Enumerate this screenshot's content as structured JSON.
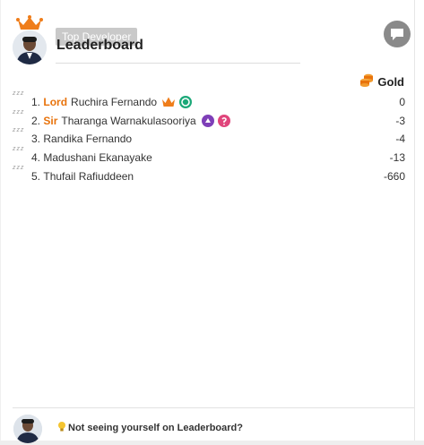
{
  "tooltip": "Top Developer",
  "header": {
    "title": "Leaderboard"
  },
  "gold_column": {
    "label": "Gold",
    "icon": "gold-coins-icon",
    "color": "#e8730c"
  },
  "leaders": [
    {
      "rank": "1.",
      "title": "Lord",
      "name": "Ruchira Fernando",
      "value": "0",
      "badges": [
        "crown-icon",
        "green-badge-icon"
      ]
    },
    {
      "rank": "2.",
      "title": "Sir",
      "name": "Tharanga Warnakulasooriya",
      "value": "-3",
      "badges": [
        "purple-badge-icon",
        "pink-badge-icon"
      ]
    },
    {
      "rank": "3.",
      "title": "",
      "name": "Randika Fernando",
      "value": "-4",
      "badges": []
    },
    {
      "rank": "4.",
      "title": "",
      "name": "Madushani Ekanayake",
      "value": "-13",
      "badges": []
    },
    {
      "rank": "5.",
      "title": "",
      "name": "Thufail Rafiuddeen",
      "value": "-660",
      "badges": []
    }
  ],
  "idle_marker": "z z z",
  "footer": {
    "prompt": "Not seeing yourself on Leaderboard?"
  },
  "colors": {
    "accent": "#e8730c",
    "green": "#1ba878",
    "purple": "#7e3fb8",
    "pink": "#e0457b"
  }
}
